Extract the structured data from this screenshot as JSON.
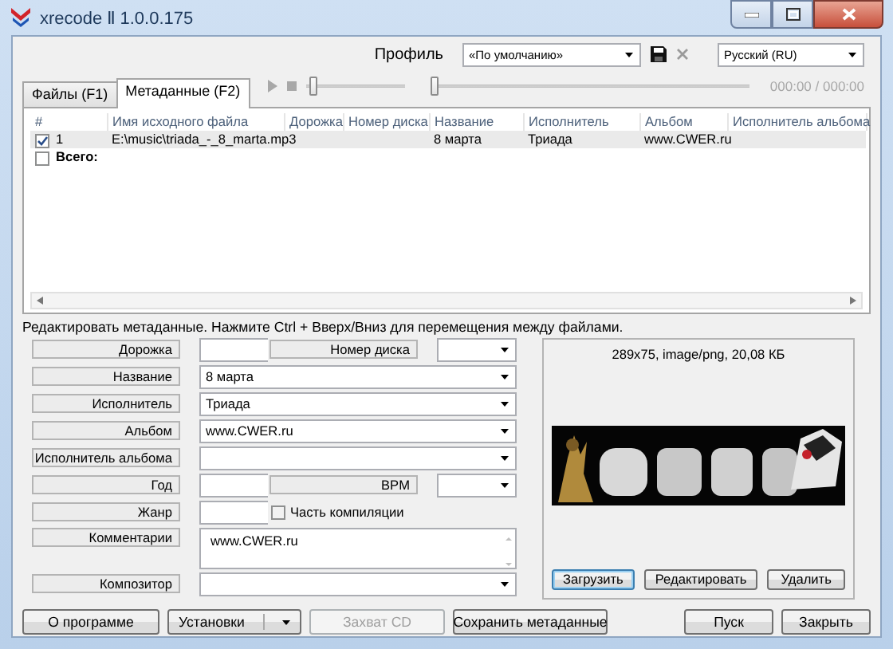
{
  "window": {
    "title": "xrecode Ⅱ 1.0.0.175"
  },
  "toolbar": {
    "profile_label": "Профиль",
    "profile": "«По умолчанию»",
    "language": "Русский (RU)"
  },
  "tabs": [
    {
      "label": "Файлы (F1)",
      "selected": false
    },
    {
      "label": "Метаданные (F2)",
      "selected": true
    }
  ],
  "player": {
    "volume": {
      "level": 0.05
    },
    "seek": {
      "level": 0
    },
    "time": "000:00 / 000:00"
  },
  "table": {
    "columns": [
      "#",
      "Имя исходного файла",
      "Дорожка",
      "Номер диска",
      "Название",
      "Исполнитель",
      "Альбом",
      "Исполнитель альбома"
    ],
    "rows": [
      {
        "checked": true,
        "selected": true,
        "number": "1",
        "file": "E:\\music\\triada_-_8_marta.mp3",
        "title": "8 марта",
        "artist": "Триада",
        "album": "www.CWER.ru"
      }
    ],
    "total": {
      "label": "Всего:",
      "checked": false
    }
  },
  "hint": "Редактировать метаданные. Нажмите Ctrl + Вверх/Вниз для перемещения между файлами.",
  "fields": [
    {
      "kind": "pair",
      "label": "Дорожка",
      "label2": "Номер диска"
    },
    {
      "kind": "combo",
      "label": "Название",
      "value": "8 марта"
    },
    {
      "kind": "combo",
      "label": "Исполнитель",
      "value": "Триада"
    },
    {
      "kind": "combo",
      "label": "Альбом",
      "value": "www.CWER.ru"
    },
    {
      "kind": "combo",
      "label": "Исполнитель альбома"
    },
    {
      "kind": "pair",
      "label": "Год",
      "label2": "BPM"
    },
    {
      "kind": "check",
      "label": "Жанр",
      "check_label": "Часть компиляции",
      "checked": false
    },
    {
      "kind": "memo",
      "label": "Комментарии",
      "value": "www.CWER.ru"
    },
    {
      "kind": "combo",
      "label": "Композитор"
    }
  ],
  "cover": {
    "info": "289x75, image/png, 20,08 КБ",
    "buttons": [
      {
        "label": "Загрузить",
        "focused": true
      },
      {
        "label": "Редактировать",
        "focused": false
      },
      {
        "label": "Удалить",
        "focused": false
      }
    ]
  },
  "bottom": {
    "left": [
      {
        "label": "О программе",
        "kind": "plain",
        "disabled": false
      },
      {
        "label": "Установки",
        "kind": "menu",
        "disabled": false
      },
      {
        "label": "Захват CD",
        "kind": "plain",
        "disabled": true
      },
      {
        "label": "Сохранить метаданные",
        "kind": "plain",
        "disabled": false
      }
    ],
    "right": [
      {
        "label": "Пуск",
        "disabled": false
      },
      {
        "label": "Закрыть",
        "disabled": false
      }
    ]
  }
}
